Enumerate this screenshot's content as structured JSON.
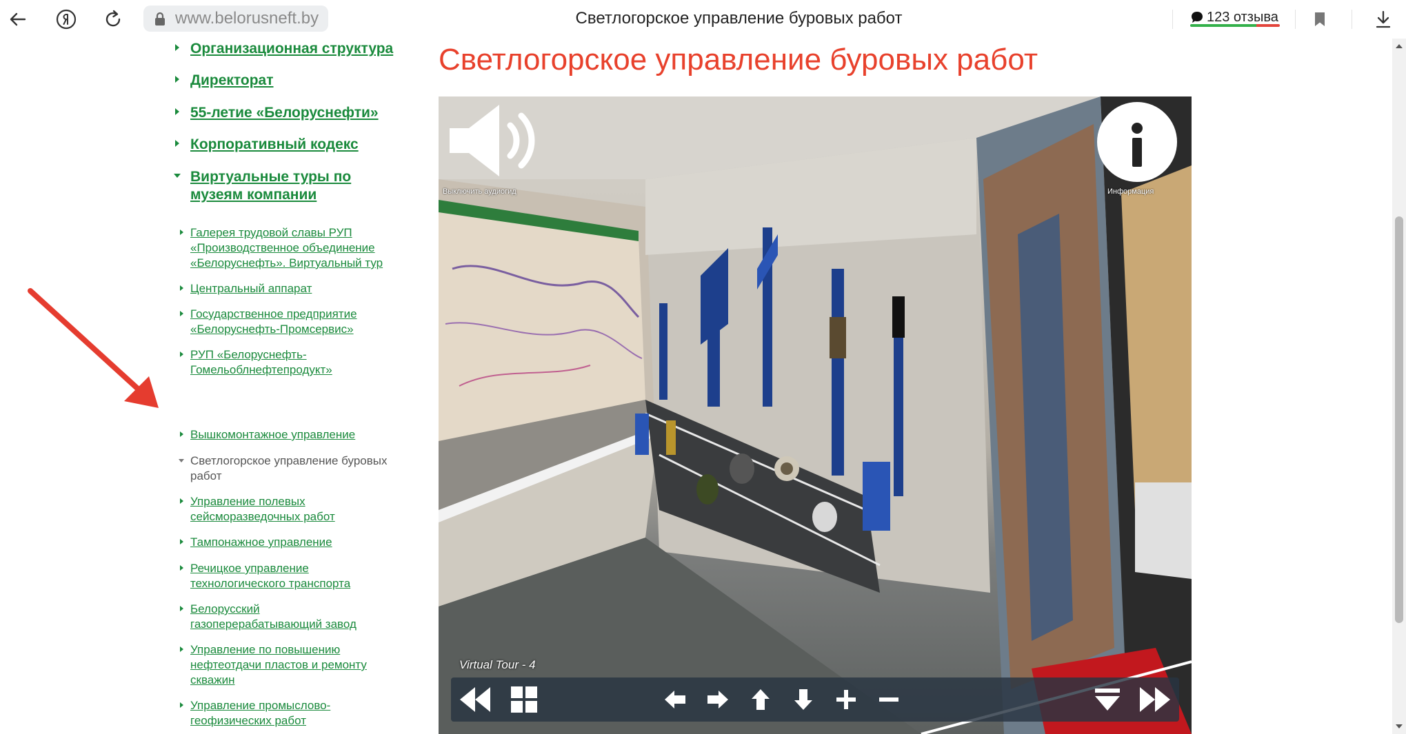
{
  "browser": {
    "url": "www.belorusneft.by",
    "tab_title": "Светлогорское управление буровых работ",
    "reviews_label": "123 отзыва",
    "icons": [
      "back-arrow-icon",
      "yandex-icon",
      "reload-icon",
      "lock-icon",
      "comment-icon",
      "bookmark-icon",
      "download-icon"
    ]
  },
  "sidebar": {
    "top_items": [
      {
        "label": "Организационная структура"
      },
      {
        "label": "Директорат"
      },
      {
        "label": "55-летие «Белоруснефти»"
      },
      {
        "label": "Корпоративный кодекс"
      },
      {
        "label": "Виртуальные туры по музеям компании",
        "expanded": true
      }
    ],
    "sub_items": [
      {
        "label": "Галерея трудовой славы РУП «Производственное объединение «Белоруснефть». Виртуальный тур"
      },
      {
        "label": "Центральный аппарат"
      },
      {
        "label": "Государственное предприятие «Белоруснефть-Промсервис»"
      },
      {
        "label": "РУП «Белоруснефть-Гомельоблнефтепродукт»"
      },
      {
        "label": "Вышкомонтажное управление"
      },
      {
        "label": "Светлогорское управление буровых работ",
        "active": true
      },
      {
        "label": "Управление полевых сейсморазведочных работ"
      },
      {
        "label": "Тампонажное управление"
      },
      {
        "label": "Речицкое управление технологического транспорта"
      },
      {
        "label": "Белорусский газоперерабатывающий завод"
      },
      {
        "label": "Управление по повышению нефтеотдачи пластов и ремонту скважин"
      },
      {
        "label": "Управление промыслово-геофизических работ"
      }
    ]
  },
  "main": {
    "title": "Светлогорское управление буровых работ",
    "tour": {
      "audio_label": "Выключить аудиогид",
      "info_label": "Информация",
      "caption": "Virtual Tour - 4",
      "toolbar": [
        "rewind-icon",
        "grid-icon",
        "arrow-left-icon",
        "arrow-right-icon",
        "arrow-up-icon",
        "arrow-down-icon",
        "zoom-in-icon",
        "zoom-out-icon",
        "hide-toolbar-icon",
        "fast-forward-icon"
      ]
    }
  },
  "colors": {
    "link_green": "#1a8a3c",
    "title_red": "#e8412c",
    "annotation_red": "#e53c2f"
  }
}
